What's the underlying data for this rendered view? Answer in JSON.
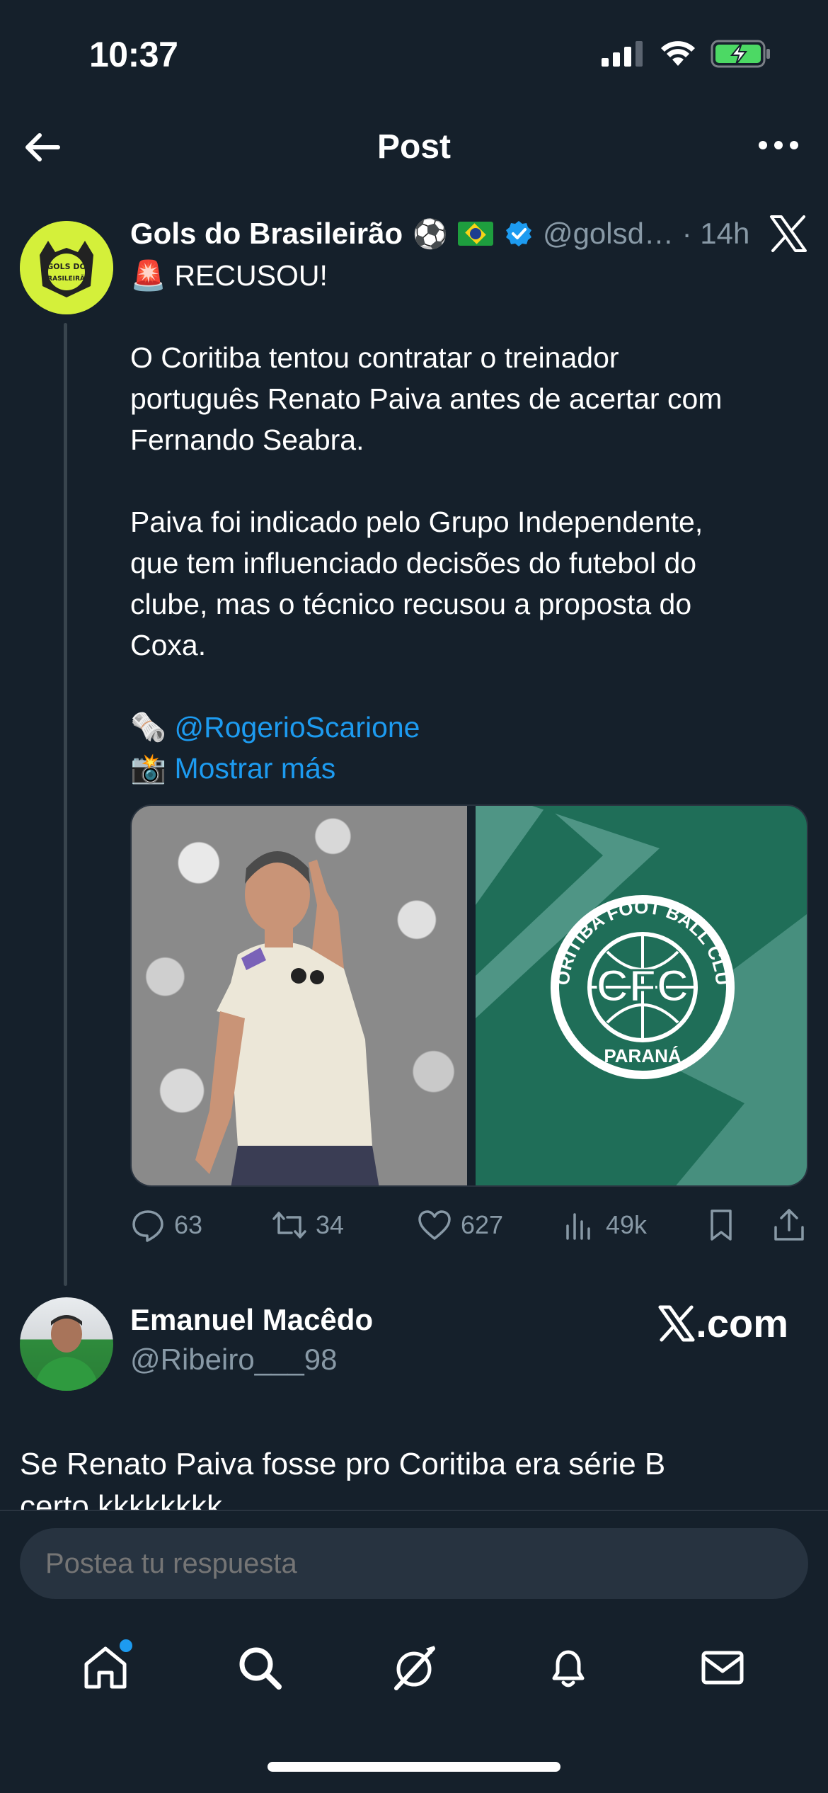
{
  "status_bar": {
    "time": "10:37"
  },
  "header": {
    "title": "Post"
  },
  "tweet": {
    "author_name": "Gols do Brasileirão",
    "author_emoji": "⚽",
    "handle_time": "@golsd… · 14h",
    "avatar_text": "GOLS DO BRASILEIRÃO",
    "lines": [
      "🚨 RECUSOU!",
      "",
      "O Coritiba tentou contratar o treinador",
      "português Renato Paiva antes de acertar com",
      "Fernando Seabra.",
      "",
      "Paiva foi indicado pelo Grupo Independente,",
      "que tem influenciado decisões do futebol do",
      "clube, mas o técnico recusou a proposta do",
      "Coxa.",
      ""
    ],
    "mention_emoji": "🗞️",
    "mention": "@RogerioScarione",
    "more_emoji": "📸",
    "more_label": "Mostrar más",
    "media_crest": {
      "top": "CORITIBA FOOT BALL CLUB",
      "center": "CFC",
      "bottom": "PARANÁ"
    },
    "stats": {
      "replies": "63",
      "reposts": "34",
      "likes": "627",
      "views": "49k"
    }
  },
  "reply": {
    "name": "Emanuel Macêdo",
    "handle": "@Ribeiro___98",
    "source": ".com",
    "text": "Se Renato Paiva fosse pro Coritiba era série B",
    "text_cut": "certo kkkkkkkk"
  },
  "composer": {
    "placeholder": "Postea tu respuesta"
  },
  "colors": {
    "background": "#15202b",
    "accent": "#1d9bf0",
    "muted": "#8899a6"
  }
}
